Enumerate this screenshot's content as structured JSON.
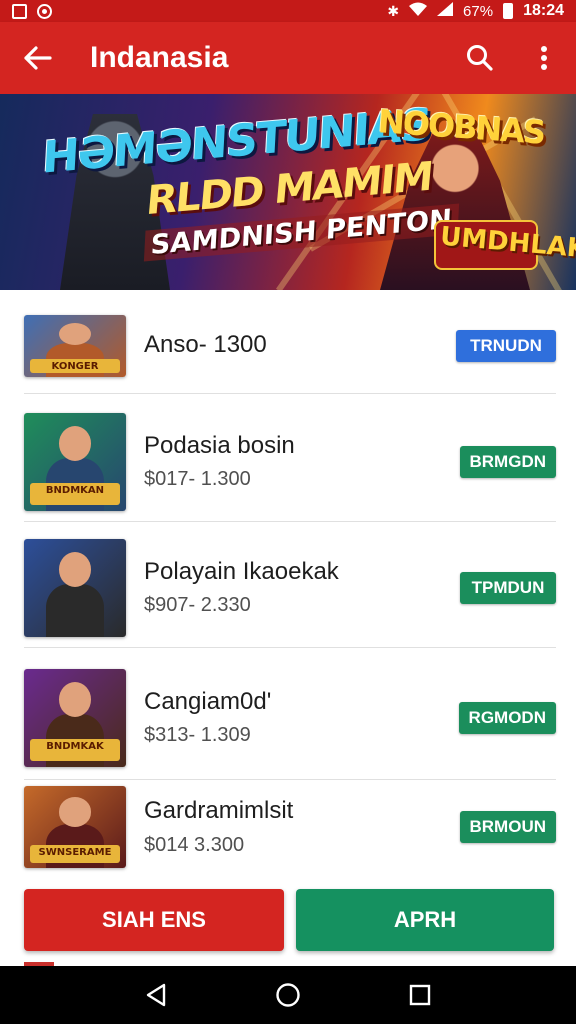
{
  "status_bar": {
    "battery": "67%",
    "time": "18:24"
  },
  "app_bar": {
    "title": "Indanasia"
  },
  "banner": {
    "line1": "HƏMƏNSTUNIAS",
    "line2": "RLDD MAMIM",
    "line3": "SAMDNISH PENTON",
    "corner_title": "NOOBNAS",
    "badge": "UMDHLAK"
  },
  "items": [
    {
      "name": "Anso- 1300",
      "price": "",
      "button": "TRNUDN",
      "button_color": "#2f6fdc",
      "thumb_caption": "KONGER",
      "thumb_colors": [
        "#3f6fb5",
        "#b25a2a"
      ]
    },
    {
      "name": "Podasia bosin",
      "price": "$017- 1.300",
      "button": "BRMGDN",
      "button_color": "#1b8e5c",
      "thumb_caption": "BNDMKAN",
      "thumb_colors": [
        "#1f8e5a",
        "#27466f"
      ]
    },
    {
      "name": "Polayain Ikaoekak",
      "price": "$907- 2.330",
      "button": "TPMDUN",
      "button_color": "#1b8e5c",
      "thumb_caption": "",
      "thumb_colors": [
        "#2d4f9a",
        "#2a2a2a"
      ]
    },
    {
      "name": "Cangiam0d'",
      "price": "$313- 1.309",
      "button": "RGMODN",
      "button_color": "#1b8e5c",
      "thumb_caption": "BNDMKAK",
      "thumb_colors": [
        "#6a2a8f",
        "#4a2a1a"
      ]
    },
    {
      "name": "Gardramimlsit",
      "price": "$014 3.300",
      "button": "BRMOUN",
      "button_color": "#1b8e5c",
      "thumb_caption": "SWNSERAME",
      "thumb_colors": [
        "#c56a2a",
        "#5a1a1a"
      ]
    }
  ],
  "actions": {
    "primary": "SIAH ENS",
    "primary_color": "#d42521",
    "secondary": "APRH",
    "secondary_color": "#159160"
  },
  "colors": {
    "app_bar": "#d42521",
    "status_bar": "#c41a18"
  },
  "icons": [
    "back-arrow-icon",
    "search-icon",
    "more-vert-icon",
    "nav-back-icon",
    "nav-home-icon",
    "nav-recents-icon"
  ]
}
